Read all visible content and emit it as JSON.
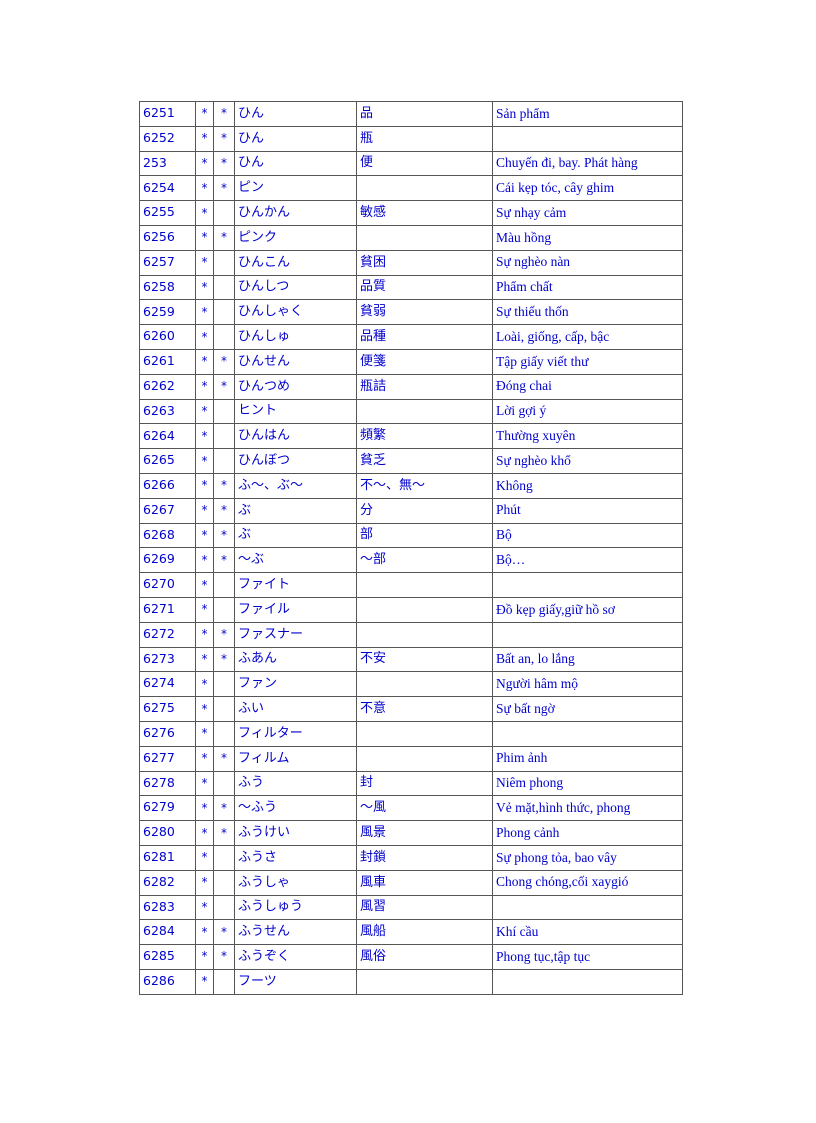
{
  "document": {
    "type": "vocabulary-table",
    "text_color": "#0000CC",
    "border_color": "#555555",
    "background_color": "#FFFFFF",
    "columns": [
      "id",
      "mark1",
      "mark2",
      "kana",
      "kanji",
      "meaning"
    ],
    "mark_glyph": "*",
    "rows": [
      {
        "id": "6251",
        "mark1": "*",
        "mark2": "*",
        "kana": "ひん",
        "kanji": "品",
        "meaning": "Sản phẩm"
      },
      {
        "id": "6252",
        "mark1": "*",
        "mark2": "*",
        "kana": "ひん",
        "kanji": "瓶",
        "meaning": ""
      },
      {
        "id": "253",
        "mark1": "*",
        "mark2": "*",
        "kana": "ひん",
        "kanji": "便",
        "meaning": "Chuyến đi, bay. Phát hàng"
      },
      {
        "id": "6254",
        "mark1": "*",
        "mark2": "*",
        "kana": "ピン",
        "kanji": "",
        "meaning": "Cái kẹp tóc, cây ghim"
      },
      {
        "id": "6255",
        "mark1": "*",
        "mark2": "",
        "kana": "ひんかん",
        "kanji": "敏感",
        "meaning": " Sự nhạy cảm"
      },
      {
        "id": "6256",
        "mark1": "*",
        "mark2": "*",
        "kana": "ピンク",
        "kanji": "",
        "meaning": "Màu hồng"
      },
      {
        "id": "6257",
        "mark1": "*",
        "mark2": "",
        "kana": "ひんこん",
        "kanji": "貧困",
        "meaning": "Sự nghèo nàn"
      },
      {
        "id": "6258",
        "mark1": "*",
        "mark2": "",
        "kana": "ひんしつ",
        "kanji": "品質",
        "meaning": "Phẩm chất"
      },
      {
        "id": "6259",
        "mark1": "*",
        "mark2": "",
        "kana": "ひんしゃく",
        "kanji": "貧弱",
        "meaning": "Sự thiếu thốn"
      },
      {
        "id": "6260",
        "mark1": "*",
        "mark2": "",
        "kana": "ひんしゅ",
        "kanji": "品種",
        "meaning": "Loài, giống, cấp, bậc"
      },
      {
        "id": "6261",
        "mark1": "*",
        "mark2": "*",
        "kana": "ひんせん",
        "kanji": "便箋",
        "meaning": "Tập giấy  viết thư"
      },
      {
        "id": "6262",
        "mark1": "*",
        "mark2": "*",
        "kana": "ひんつめ",
        "kanji": "瓶詰",
        "meaning": "Đóng chai"
      },
      {
        "id": "6263",
        "mark1": "*",
        "mark2": "",
        "kana": "ヒント",
        "kanji": "",
        "meaning": "Lời gợi ý"
      },
      {
        "id": "6264",
        "mark1": "*",
        "mark2": "",
        "kana": "ひんはん",
        "kanji": "頻繁",
        "meaning": "Thường xuyên"
      },
      {
        "id": "6265",
        "mark1": "*",
        "mark2": "",
        "kana": "ひんぼつ",
        "kanji": "貧乏",
        "meaning": "Sự nghèo khổ"
      },
      {
        "id": "6266",
        "mark1": "*",
        "mark2": "*",
        "kana": "ふ〜、ぶ〜",
        "kanji": "不〜、無〜",
        "meaning": "Không"
      },
      {
        "id": "6267",
        "mark1": "*",
        "mark2": "*",
        "kana": "ぶ",
        "kanji": "分",
        "meaning": "Phút"
      },
      {
        "id": "6268",
        "mark1": "*",
        "mark2": "*",
        "kana": "ぶ",
        "kanji": "部",
        "meaning": "Bộ"
      },
      {
        "id": "6269",
        "mark1": "*",
        "mark2": "*",
        "kana": "〜ぶ",
        "kanji": "〜部",
        "meaning": "Bộ…"
      },
      {
        "id": "6270",
        "mark1": "*",
        "mark2": "",
        "kana": "ファイト",
        "kanji": "",
        "meaning": ""
      },
      {
        "id": "6271",
        "mark1": "*",
        "mark2": "",
        "kana": "ファイル",
        "kanji": "",
        "meaning": "Đồ kẹp giấy,giữ  hồ sơ"
      },
      {
        "id": "6272",
        "mark1": "*",
        "mark2": "*",
        "kana": "ファスナー",
        "kanji": "",
        "meaning": ""
      },
      {
        "id": "6273",
        "mark1": "*",
        "mark2": "*",
        "kana": "ふあん",
        "kanji": "不安",
        "meaning": "Bất an, lo lắng"
      },
      {
        "id": "6274",
        "mark1": "*",
        "mark2": "",
        "kana": "ファン",
        "kanji": "",
        "meaning": "Người hâm mộ"
      },
      {
        "id": "6275",
        "mark1": "*",
        "mark2": "",
        "kana": "ふい",
        "kanji": "不意",
        "meaning": "Sự bất ngờ"
      },
      {
        "id": "6276",
        "mark1": "*",
        "mark2": "",
        "kana": "フィルター",
        "kanji": "",
        "meaning": ""
      },
      {
        "id": "6277",
        "mark1": "*",
        "mark2": "*",
        "kana": "フィルム",
        "kanji": "",
        "meaning": "Phim  ảnh"
      },
      {
        "id": "6278",
        "mark1": "*",
        "mark2": "",
        "kana": "ふう",
        "kanji": "封",
        "meaning": "Niêm phong"
      },
      {
        "id": "6279",
        "mark1": "*",
        "mark2": "*",
        "kana": "〜ふう",
        "kanji": "〜風",
        "meaning": "Vẻ mặt,hình  thức, phong"
      },
      {
        "id": "6280",
        "mark1": "*",
        "mark2": "*",
        "kana": "ふうけい",
        "kanji": "風景",
        "meaning": "Phong cảnh"
      },
      {
        "id": "6281",
        "mark1": "*",
        "mark2": "",
        "kana": "ふうさ",
        "kanji": "封鎖",
        "meaning": "Sự phong tỏa, bao vây"
      },
      {
        "id": "6282",
        "mark1": "*",
        "mark2": "",
        "kana": "ふうしゃ",
        "kanji": "風車",
        "meaning": "Chong chóng,cối  xaygió"
      },
      {
        "id": "6283",
        "mark1": "*",
        "mark2": "",
        "kana": "ふうしゅう",
        "kanji": "風習",
        "meaning": ""
      },
      {
        "id": "6284",
        "mark1": "*",
        "mark2": "*",
        "kana": "ふうせん",
        "kanji": "風船",
        "meaning": "Khí cầu"
      },
      {
        "id": "6285",
        "mark1": "*",
        "mark2": "*",
        "kana": "ふうぞく",
        "kanji": "風俗",
        "meaning": "Phong tục,tập tục"
      },
      {
        "id": "6286",
        "mark1": "*",
        "mark2": "",
        "kana": "フーツ",
        "kanji": "",
        "meaning": ""
      }
    ]
  }
}
